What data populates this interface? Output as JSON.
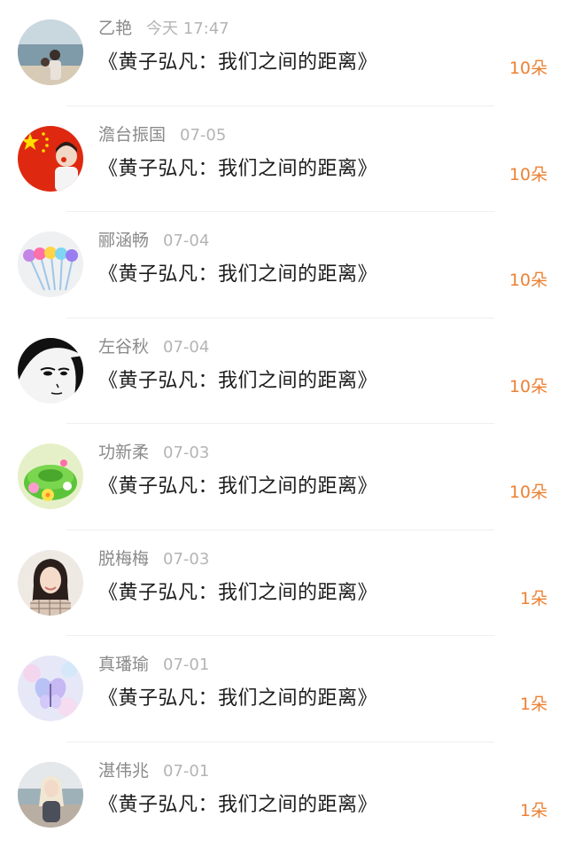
{
  "gift_list": [
    {
      "name": "乙艳",
      "time": "今天 17:47",
      "title": "《黄子弘凡：我们之间的距离》",
      "count": "10朵",
      "avatar": "beach-couple-avatar"
    },
    {
      "name": "澹台振国",
      "time": "07-05",
      "title": "《黄子弘凡：我们之间的距离》",
      "count": "10朵",
      "avatar": "china-flag-avatar"
    },
    {
      "name": "郦涵畅",
      "time": "07-04",
      "title": "《黄子弘凡：我们之间的距离》",
      "count": "10朵",
      "avatar": "pom-pom-pens-avatar"
    },
    {
      "name": "左谷秋",
      "time": "07-04",
      "title": "《黄子弘凡：我们之间的距离》",
      "count": "10朵",
      "avatar": "manga-face-avatar"
    },
    {
      "name": "功新柔",
      "time": "07-03",
      "title": "《黄子弘凡：我们之间的距离》",
      "count": "10朵",
      "avatar": "green-cake-avatar"
    },
    {
      "name": "脱梅梅",
      "time": "07-03",
      "title": "《黄子弘凡：我们之间的距离》",
      "count": "1朵",
      "avatar": "girl-portrait-avatar"
    },
    {
      "name": "真璠瑜",
      "time": "07-01",
      "title": "《黄子弘凡：我们之间的距离》",
      "count": "1朵",
      "avatar": "butterfly-avatar"
    },
    {
      "name": "湛伟兆",
      "time": "07-01",
      "title": "《黄子弘凡：我们之间的距离》",
      "count": "1朵",
      "avatar": "seaside-girl-avatar"
    }
  ],
  "colors": {
    "count_accent": "#ec8234",
    "name_gray": "#8a8a8a",
    "time_gray": "#b4b4b4",
    "title_dark": "#1c1c1c"
  }
}
